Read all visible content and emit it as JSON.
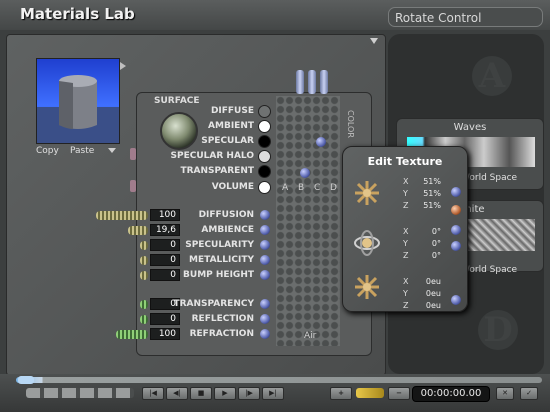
{
  "app": {
    "title": "Materials Lab",
    "rotate_control": "Rotate Control"
  },
  "preview": {
    "copy_label": "Copy",
    "paste_label": "Paste"
  },
  "surface": {
    "header": "SURFACE",
    "items": [
      {
        "label": "DIFFUSE",
        "color": "#6f7272"
      },
      {
        "label": "AMBIENT",
        "color": "#ffffff"
      },
      {
        "label": "SPECULAR",
        "color": "#000000"
      },
      {
        "label": "SPECULAR HALO",
        "color": "#dcdcdc"
      },
      {
        "label": "TRANSPARENT",
        "color": "#000000"
      },
      {
        "label": "VOLUME",
        "color": "#ffffff"
      }
    ],
    "channels": [
      "A",
      "B",
      "C",
      "D"
    ]
  },
  "properties": [
    {
      "label": "DIFFUSION",
      "value": "100"
    },
    {
      "label": "AMBIENCE",
      "value": "19,6"
    },
    {
      "label": "SPECULARITY",
      "value": "0"
    },
    {
      "label": "METALLICITY",
      "value": "0"
    },
    {
      "label": "BUMP HEIGHT",
      "value": "0"
    }
  ],
  "properties2": [
    {
      "label": "TRANSPARENCY",
      "value": "0"
    },
    {
      "label": "REFLECTION",
      "value": "0"
    },
    {
      "label": "REFRACTION",
      "value": "100"
    }
  ],
  "air_label": "Air",
  "edit_texture": {
    "title": "Edit Texture",
    "scale": [
      {
        "axis": "X",
        "value": "51%"
      },
      {
        "axis": "Y",
        "value": "51%"
      },
      {
        "axis": "Z",
        "value": "51%"
      }
    ],
    "rotate": [
      {
        "axis": "X",
        "value": "0°"
      },
      {
        "axis": "Y",
        "value": "0°"
      },
      {
        "axis": "Z",
        "value": "0°"
      }
    ],
    "move": [
      {
        "axis": "X",
        "value": "0eu"
      },
      {
        "axis": "Y",
        "value": "0eu"
      },
      {
        "axis": "Z",
        "value": "0eu"
      }
    ]
  },
  "textures": {
    "waves": {
      "title": "Waves",
      "space": "World Space"
    },
    "white": {
      "title": "White",
      "space": "World Space"
    }
  },
  "right_letters": [
    "A",
    "D"
  ],
  "timeline": {
    "timecode": "00:00:00.00"
  }
}
